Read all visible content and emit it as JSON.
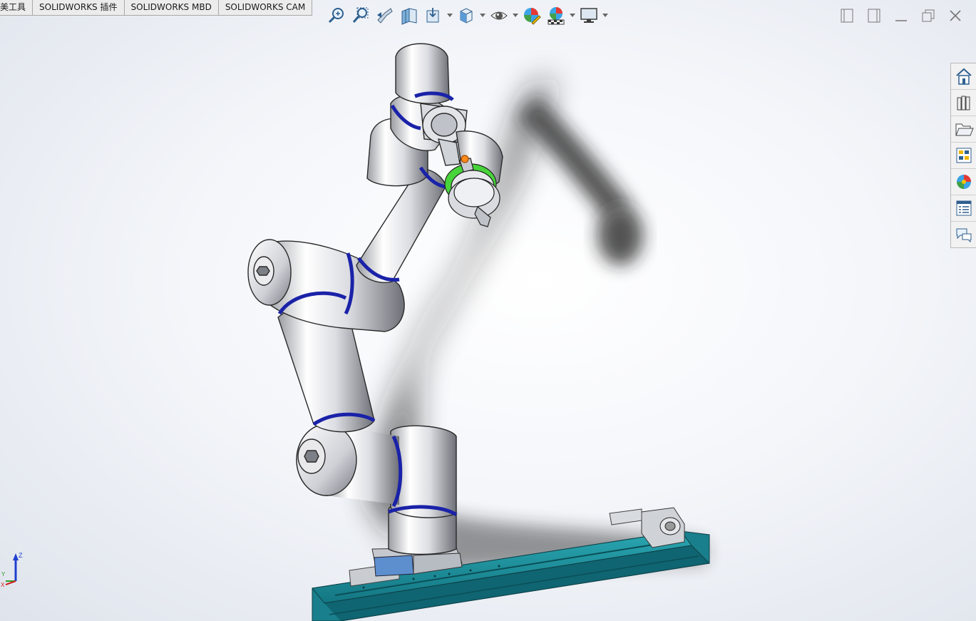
{
  "tabs": [
    {
      "label": "美工具"
    },
    {
      "label": "SOLIDWORKS 插件"
    },
    {
      "label": "SOLIDWORKS MBD"
    },
    {
      "label": "SOLIDWORKS CAM"
    }
  ],
  "heads_up_toolbar": [
    {
      "icon": "zoom-to-fit-icon"
    },
    {
      "icon": "zoom-to-area-icon"
    },
    {
      "icon": "previous-view-icon"
    },
    {
      "icon": "section-view-icon"
    },
    {
      "icon": "dynamic-annotation-views-icon"
    },
    {
      "icon": "view-orientation-icon"
    },
    {
      "icon": "display-style-icon"
    },
    {
      "icon": "hide-show-items-icon"
    },
    {
      "icon": "edit-appearance-icon"
    },
    {
      "icon": "apply-scene-icon"
    },
    {
      "icon": "view-settings-icon"
    }
  ],
  "window_controls": [
    {
      "icon": "restore-left-icon"
    },
    {
      "icon": "restore-right-icon"
    },
    {
      "icon": "minimize-icon"
    },
    {
      "icon": "maximize-icon"
    },
    {
      "icon": "close-icon"
    }
  ],
  "task_pane": [
    {
      "icon": "solidworks-resources-icon"
    },
    {
      "icon": "design-library-icon"
    },
    {
      "icon": "file-explorer-icon"
    },
    {
      "icon": "view-palette-icon"
    },
    {
      "icon": "appearances-scenes-icon"
    },
    {
      "icon": "custom-properties-icon"
    },
    {
      "icon": "solidworks-forum-icon"
    }
  ],
  "triad": {
    "z": "Z",
    "y": "Y",
    "x": "X"
  },
  "colors": {
    "arm_band": "#1a22a8",
    "rail": "#1f8e9a",
    "gripper_ring": "#44cc33",
    "accent_orange": "#ff8a1c"
  }
}
